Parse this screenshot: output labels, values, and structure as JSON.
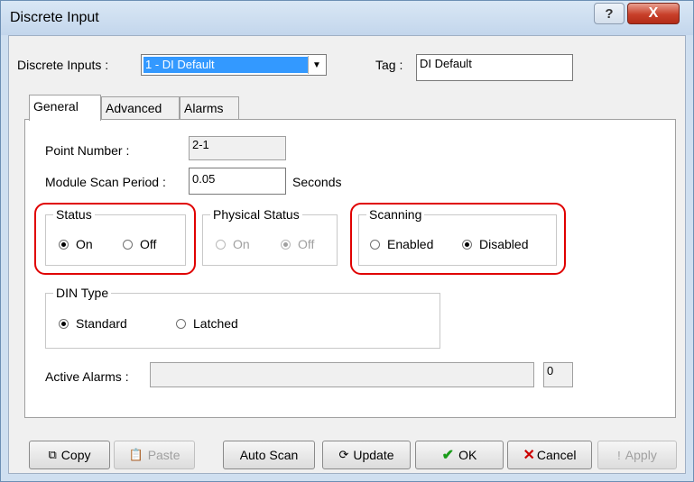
{
  "window": {
    "title": "Discrete Input",
    "help_icon": "?",
    "close_icon": "X"
  },
  "top": {
    "discrete_inputs_label": "Discrete Inputs :",
    "discrete_inputs_value": "1 - DI Default",
    "tag_label": "Tag :",
    "tag_value": "DI Default"
  },
  "tabs": [
    {
      "label": "General",
      "active": true
    },
    {
      "label": "Advanced",
      "active": false
    },
    {
      "label": "Alarms",
      "active": false
    }
  ],
  "general": {
    "point_number_label": "Point Number :",
    "point_number_value": "2-1",
    "scan_period_label": "Module Scan Period :",
    "scan_period_value": "0.05",
    "scan_period_unit": "Seconds",
    "status": {
      "legend": "Status",
      "on": "On",
      "off": "Off",
      "selected": "On"
    },
    "physical_status": {
      "legend": "Physical Status",
      "on": "On",
      "off": "Off",
      "selected": "Off"
    },
    "scanning": {
      "legend": "Scanning",
      "enabled": "Enabled",
      "disabled": "Disabled",
      "selected": "Disabled"
    },
    "din_type": {
      "legend": "DIN Type",
      "standard": "Standard",
      "latched": "Latched",
      "selected": "Standard"
    },
    "active_alarms_label": "Active Alarms :",
    "active_alarms_value": "",
    "active_alarms_count": "0"
  },
  "buttons": {
    "copy": "Copy",
    "paste": "Paste",
    "auto_scan": "Auto Scan",
    "update": "Update",
    "ok": "OK",
    "cancel": "Cancel",
    "apply": "Apply"
  },
  "colors": {
    "highlight": "#e00000",
    "selection": "#3399ff",
    "ok_check": "#1a9c1a",
    "cancel_x": "#cc0000"
  }
}
